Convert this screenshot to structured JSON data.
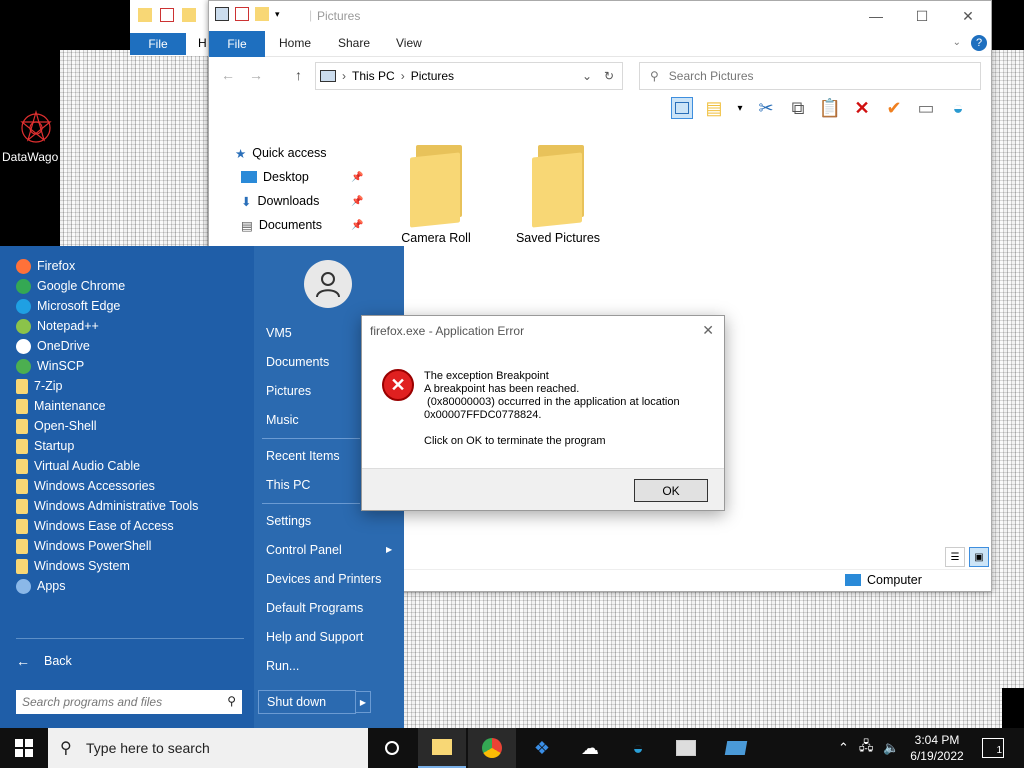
{
  "desktop": {
    "icon_label": "DataWago"
  },
  "back_window": {
    "file_tab": "File",
    "h_tab": "H"
  },
  "explorer": {
    "title": "Pictures",
    "tabs": [
      "File",
      "Home",
      "Share",
      "View"
    ],
    "address": {
      "segments": [
        "This PC",
        "Pictures"
      ]
    },
    "search_placeholder": "Search Pictures",
    "nav_pane": [
      {
        "label": "Quick access",
        "icon": "star-icon",
        "pinned": false
      },
      {
        "label": "Desktop",
        "icon": "desktop-icon",
        "pinned": true
      },
      {
        "label": "Downloads",
        "icon": "download-icon",
        "pinned": true
      },
      {
        "label": "Documents",
        "icon": "documents-icon",
        "pinned": true
      }
    ],
    "folders": [
      "Camera Roll",
      "Saved Pictures"
    ],
    "status_location": "Computer"
  },
  "start_menu": {
    "programs": [
      {
        "label": "Firefox",
        "icon": "firefox-icon",
        "color": "#ff7139"
      },
      {
        "label": "Google Chrome",
        "icon": "chrome-icon",
        "color": "#34a853"
      },
      {
        "label": "Microsoft Edge",
        "icon": "edge-icon",
        "color": "#1fa0e3"
      },
      {
        "label": "Notepad++",
        "icon": "notepadpp-icon",
        "color": "#8bc34a"
      },
      {
        "label": "OneDrive",
        "icon": "onedrive-icon",
        "color": "#ffffff"
      },
      {
        "label": "WinSCP",
        "icon": "winscp-icon",
        "color": "#4caf50"
      },
      {
        "label": "7-Zip",
        "icon": "folder-icon",
        "color": "#f8d775"
      },
      {
        "label": "Maintenance",
        "icon": "folder-icon",
        "color": "#f8d775"
      },
      {
        "label": "Open-Shell",
        "icon": "folder-icon",
        "color": "#f8d775"
      },
      {
        "label": "Startup",
        "icon": "folder-icon",
        "color": "#f8d775"
      },
      {
        "label": "Virtual Audio Cable",
        "icon": "folder-icon",
        "color": "#f8d775"
      },
      {
        "label": "Windows Accessories",
        "icon": "folder-icon",
        "color": "#f8d775"
      },
      {
        "label": "Windows Administrative Tools",
        "icon": "folder-icon",
        "color": "#f8d775"
      },
      {
        "label": "Windows Ease of Access",
        "icon": "folder-icon",
        "color": "#f8d775"
      },
      {
        "label": "Windows PowerShell",
        "icon": "folder-icon",
        "color": "#f8d775"
      },
      {
        "label": "Windows System",
        "icon": "folder-icon",
        "color": "#f8d775"
      },
      {
        "label": "Apps",
        "icon": "apps-icon",
        "color": "#8bb8e8"
      }
    ],
    "back_label": "Back",
    "search_placeholder": "Search programs and files",
    "right_items": {
      "user": "VM5",
      "documents": "Documents",
      "pictures": "Pictures",
      "music": "Music",
      "recent": "Recent Items",
      "this_pc": "This PC",
      "settings": "Settings",
      "control_panel": "Control Panel",
      "devices": "Devices and Printers",
      "default_programs": "Default Programs",
      "help": "Help and Support",
      "run": "Run..."
    },
    "shutdown_label": "Shut down"
  },
  "dialog": {
    "title": "firefox.exe - Application Error",
    "message": "The exception Breakpoint\nA breakpoint has been reached.\n (0x80000003) occurred in the application at location\n0x00007FFDC0778824.",
    "message2": "Click on OK to terminate the program",
    "ok_label": "OK"
  },
  "taskbar": {
    "search_placeholder": "Type here to search",
    "time": "3:04 PM",
    "date": "6/19/2022",
    "notification_count": "1"
  }
}
